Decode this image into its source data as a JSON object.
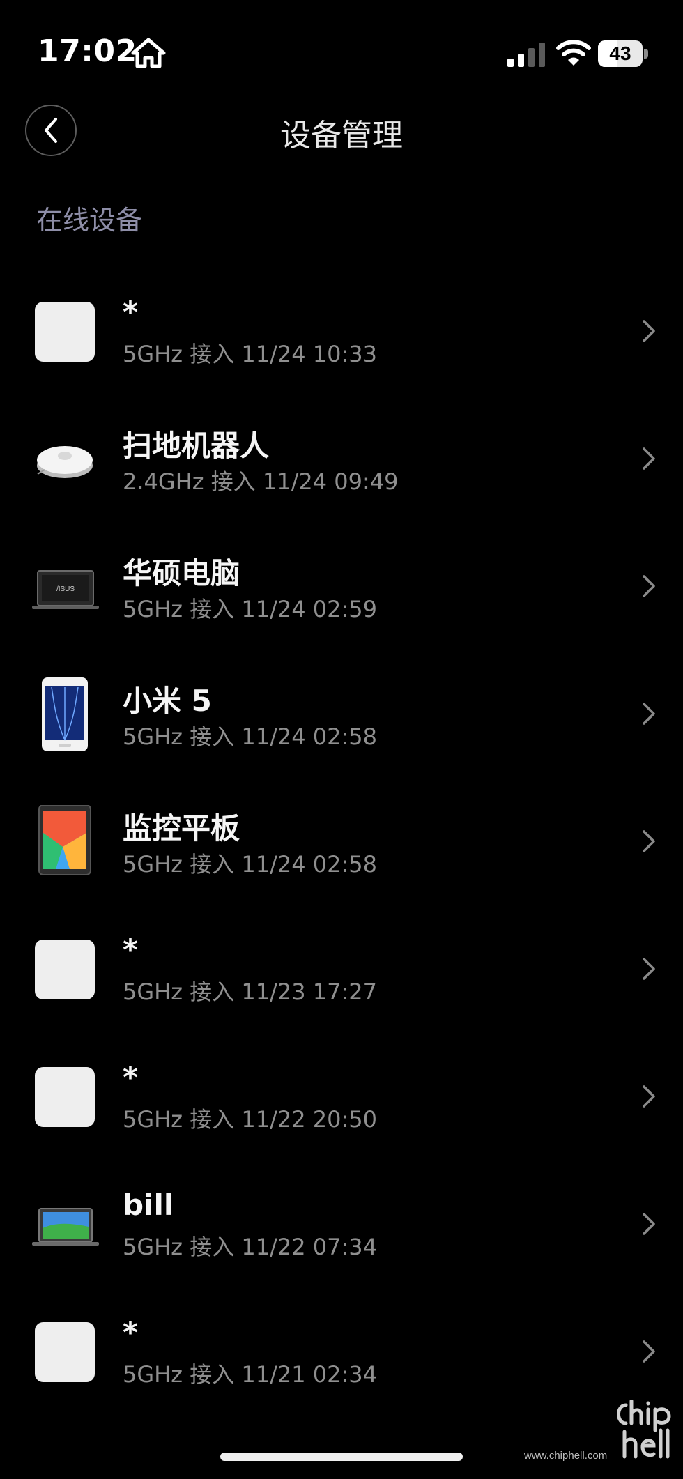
{
  "status_bar": {
    "time": "17:02",
    "home_icon": "house-icon",
    "signal_icon": "cellular-signal-icon",
    "wifi_icon": "wifi-icon",
    "battery_level": 43,
    "battery_text": "43"
  },
  "header": {
    "back_icon": "chevron-left-icon",
    "title": "设备管理"
  },
  "section": {
    "title": "在线设备"
  },
  "devices": [
    {
      "name": "*",
      "meta": "5GHz 接入  11/24 10:33",
      "icon": "blank-device-icon"
    },
    {
      "name": "扫地机器人",
      "meta": "2.4GHz 接入  11/24 09:49",
      "icon": "robot-vacuum-icon"
    },
    {
      "name": "华硕电脑",
      "meta": "5GHz 接入  11/24 02:59",
      "icon": "laptop-icon"
    },
    {
      "name": "小米 5",
      "meta": "5GHz 接入  11/24 02:58",
      "icon": "smartphone-icon"
    },
    {
      "name": "监控平板",
      "meta": "5GHz 接入  11/24 02:58",
      "icon": "tablet-icon"
    },
    {
      "name": "*",
      "meta": "5GHz 接入  11/23 17:27",
      "icon": "blank-device-icon"
    },
    {
      "name": "*",
      "meta": "5GHz 接入  11/22 20:50",
      "icon": "blank-device-icon"
    },
    {
      "name": "bill",
      "meta": "5GHz 接入  11/22 07:34",
      "icon": "laptop-icon"
    },
    {
      "name": "*",
      "meta": "5GHz 接入  11/21 02:34",
      "icon": "blank-device-icon"
    }
  ],
  "chevron_icon": "chevron-right-icon",
  "watermark": {
    "logo": "chiphell",
    "url": "www.chiphell.com"
  },
  "colors": {
    "background": "#000000",
    "section_title": "#8e8ea8",
    "meta_text": "#8f8f8f"
  }
}
